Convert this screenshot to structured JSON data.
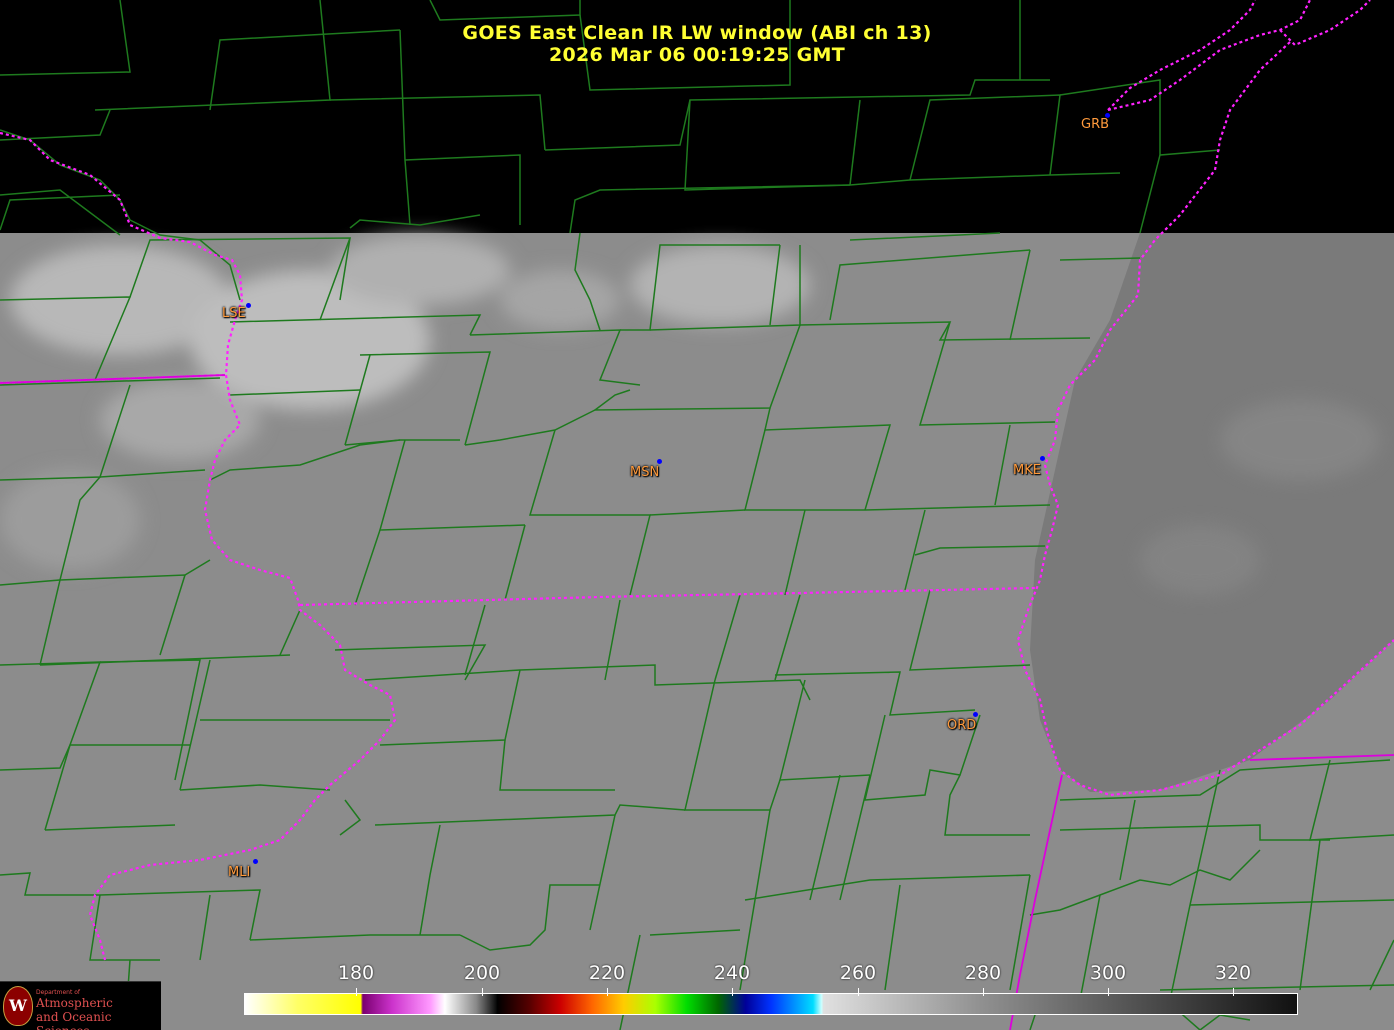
{
  "title": {
    "line1": "GOES East Clean IR LW window (ABI ch 13)",
    "line2": "2026 Mar 06  00:19:25 GMT"
  },
  "stations": [
    {
      "id": "GRB",
      "label": "GRB"
    },
    {
      "id": "LSE",
      "label": "LSE"
    },
    {
      "id": "MSN",
      "label": "MSN"
    },
    {
      "id": "MKE",
      "label": "MKE"
    },
    {
      "id": "ORD",
      "label": "ORD"
    },
    {
      "id": "MLI",
      "label": "MLI"
    }
  ],
  "colorbar": {
    "unit_note": "",
    "ticks": [
      "180",
      "200",
      "220",
      "240",
      "260",
      "280",
      "300",
      "320"
    ]
  },
  "logo": {
    "dept": "Department of",
    "line1": "Atmospheric",
    "line2": "and Oceanic Sciences",
    "seal_letter": "W"
  },
  "colors": {
    "county_lines": "#1e7a1e",
    "state_lines": "#ff33ff",
    "cloud_gray": "#8c8c8c",
    "no_data": "#000000",
    "title": "#ffff33",
    "station_label": "#ff9a3c",
    "station_dot": "#0000ff"
  }
}
